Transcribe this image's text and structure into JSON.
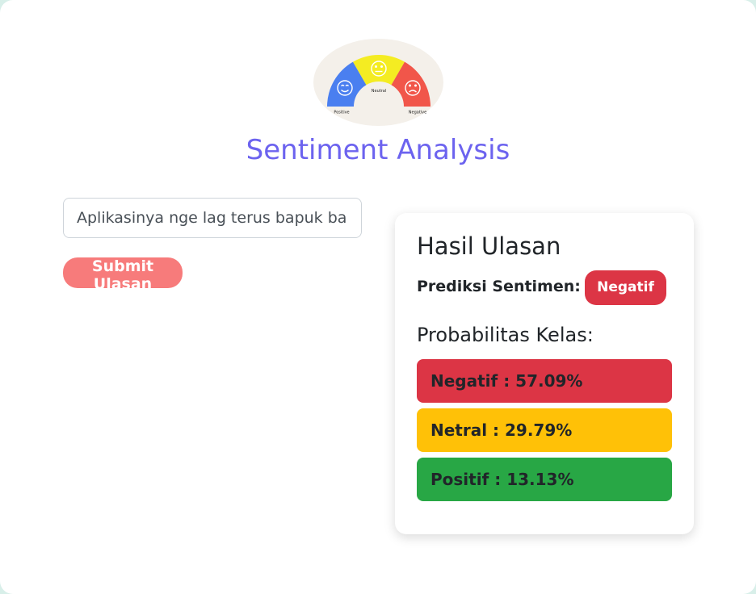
{
  "logo": {
    "segments": [
      {
        "label": "Positive",
        "color": "#4a7ff0"
      },
      {
        "label": "Neutral",
        "color": "#f4ec22"
      },
      {
        "label": "Negative",
        "color": "#f1564a"
      }
    ],
    "background": "#f4f0ea"
  },
  "header": {
    "title": "Sentiment Analysis",
    "title_color": "#6c63ef"
  },
  "form": {
    "input_value": "Aplikasinya nge lag terus bapuk banget",
    "submit_label": "Submit Ulasan",
    "submit_color": "#f77b7b"
  },
  "result": {
    "title": "Hasil Ulasan",
    "prediction_label": "Prediksi Sentimen:",
    "prediction_value": "Negatif",
    "prediction_color": "#dc3545",
    "probabilities_title": "Probabilitas Kelas:",
    "probabilities": [
      {
        "text": "Negatif : 57.09%",
        "color": "#dc3545"
      },
      {
        "text": "Netral : 29.79%",
        "color": "#ffc107"
      },
      {
        "text": "Positif : 13.13%",
        "color": "#28a745"
      }
    ]
  }
}
